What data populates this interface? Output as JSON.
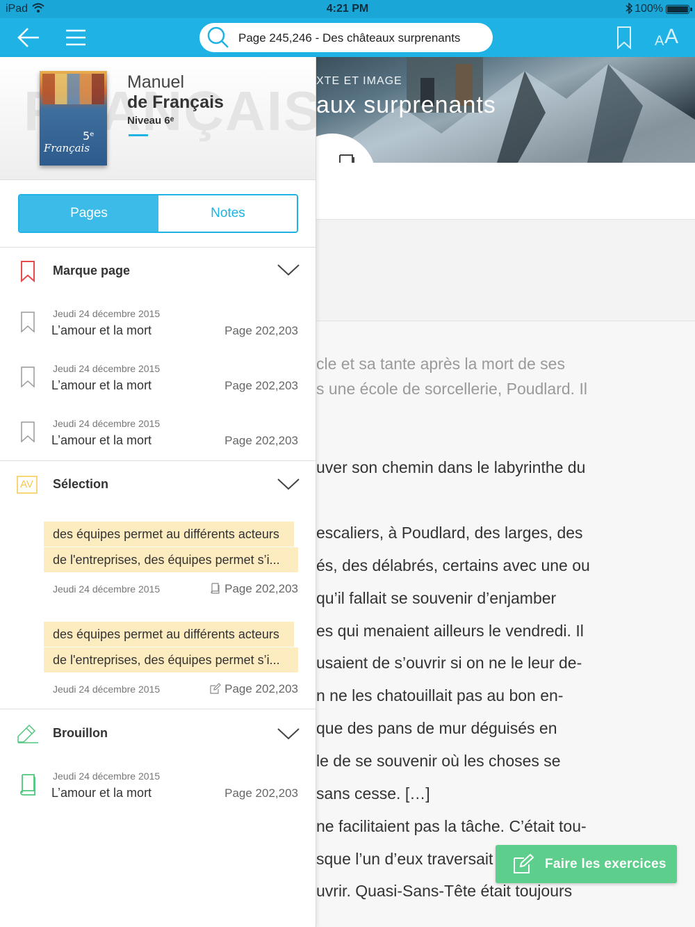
{
  "status_bar": {
    "device": "iPad",
    "time": "4:21 PM",
    "battery": "100%"
  },
  "nav": {
    "search_text": "Page 245,246 - Des châteaux surprenants",
    "text_size_small": "A",
    "text_size_large": "A"
  },
  "book": {
    "watermark": "FRANÇAIS",
    "title_line1": "Manuel",
    "title_line2": "de Français",
    "level": "Niveau 6ᵉ",
    "cover_level": "5ᵉ",
    "cover_word": "Français"
  },
  "tabs": {
    "pages": "Pages",
    "notes": "Notes"
  },
  "bookmarks": {
    "title": "Marque page",
    "items": [
      {
        "date": "Jeudi 24 décembre 2015",
        "title": "L’amour et la mort",
        "page": "Page 202,203"
      },
      {
        "date": "Jeudi 24 décembre 2015",
        "title": "L’amour et la mort",
        "page": "Page 202,203"
      },
      {
        "date": "Jeudi 24 décembre 2015",
        "title": "L’amour et la mort",
        "page": "Page 202,203"
      }
    ]
  },
  "selection": {
    "title": "Sélection",
    "icon_text": "AV",
    "items": [
      {
        "line1": "des équipes permet au différents acteurs",
        "line2": "de l'entreprises, des équipes permet s’i...",
        "date": "Jeudi 24 décembre 2015",
        "page": "Page 202,203"
      },
      {
        "line1": "des équipes permet au différents acteurs",
        "line2": "de l'entreprises, des équipes permet s’i...",
        "date": "Jeudi 24 décembre 2015",
        "page": "Page 202,203"
      }
    ]
  },
  "draft": {
    "title": "Brouillon",
    "items": [
      {
        "date": "Jeudi 24 décembre 2015",
        "title": "L’amour et la mort",
        "page": "Page 202,203"
      }
    ]
  },
  "reader": {
    "kicker": "XTE ET IMAGE",
    "heading": "aux surprenants",
    "lines": [
      "cle et sa tante après la mort de ses",
      "s une école de sorcellerie, Poudlard. Il",
      "uver son chemin dans le labyrinthe du",
      "escaliers, à Poudlard, des larges, des",
      "és, des délabrés, certains avec une ou",
      "qu’il fallait se souvenir d’enjamber",
      "es qui menaient ailleurs le vendredi. Il",
      "usaient de s’ouvrir si on ne le leur de-",
      "n ne les chatouillait pas au bon en-",
      "que des pans de mur déguisés en",
      "le de se souvenir où les choses se",
      "sans cesse. […]",
      "ne facilitaient pas la tâche. C’était tou-",
      "sque l’un d’eux traversait",
      "uvrir. Quasi-Sans-Tête était toujours"
    ]
  },
  "exercise_button": "Faire les exercices",
  "colors": {
    "nav": "#1fb2e5",
    "status": "#1ba6d8",
    "accent": "#1fb2e5",
    "bookmark_red": "#e74c4c",
    "selection_yellow": "#f2c94c",
    "draft_green": "#4fc77e",
    "highlight": "#fcecc0",
    "button_green": "#5dce8b"
  },
  "icons": [
    "back-arrow-icon",
    "menu-icon",
    "search-icon",
    "bookmark-icon",
    "text-size-icon",
    "book-icon",
    "chevron-down-icon",
    "pencil-icon",
    "edit-icon"
  ]
}
